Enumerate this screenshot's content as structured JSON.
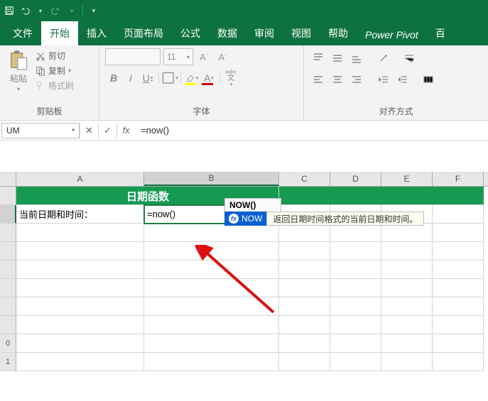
{
  "tabs": {
    "file": "文件",
    "home": "开始",
    "insert": "插入",
    "pagelayout": "页面布局",
    "formulas": "公式",
    "data": "数据",
    "review": "审阅",
    "view": "视图",
    "help": "帮助",
    "powerpivot": "Power Pivot",
    "baidu": "百"
  },
  "ribbon": {
    "paste": "粘贴",
    "cut": "剪切",
    "copy": "复制",
    "painter": "格式刷",
    "clipboard_label": "剪贴板",
    "font_label": "字体",
    "align_label": "对齐方式",
    "font_size": "11",
    "wen": "wén"
  },
  "namebox": "UM",
  "formula": "=now()",
  "columns": [
    "A",
    "B",
    "C",
    "D",
    "E",
    "F"
  ],
  "sheet": {
    "header_title": "日期函数",
    "a2": "当前日期和时间：",
    "b2": "=now()"
  },
  "functip": {
    "sig": "NOW()",
    "name": "NOW",
    "desc": "返回日期时间格式的当前日期和时间。"
  },
  "rownums": [
    "",
    "",
    "",
    "",
    "",
    "",
    "",
    "",
    "0",
    "1"
  ]
}
